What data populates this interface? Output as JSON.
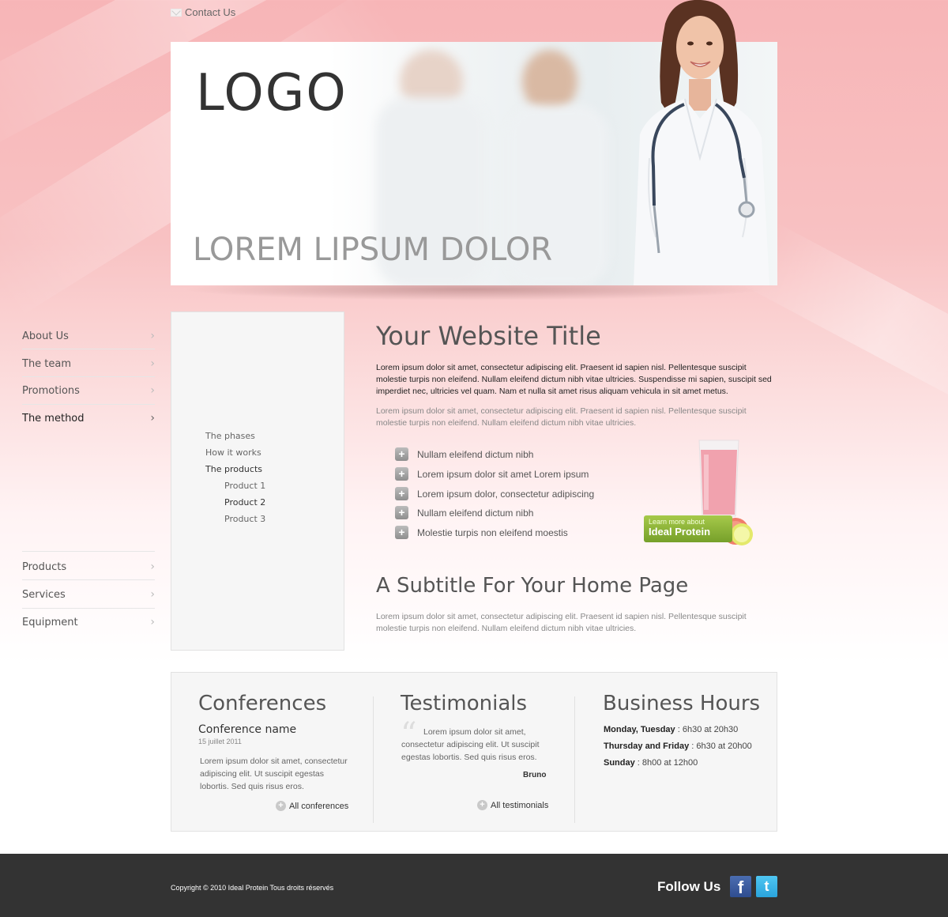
{
  "header": {
    "contact_label": "Contact Us"
  },
  "hero": {
    "logo_text": "LOGO",
    "tagline": "LOREM LIPSUM DOLOR"
  },
  "sidebar": {
    "items": [
      {
        "label": "About Us"
      },
      {
        "label": "The team"
      },
      {
        "label": "Promotions"
      },
      {
        "label": "The method"
      },
      {
        "label": "Products"
      },
      {
        "label": "Services"
      },
      {
        "label": "Equipment"
      }
    ],
    "sub_items": [
      {
        "label": "The phases"
      },
      {
        "label": "How it works"
      },
      {
        "label": "The products"
      }
    ],
    "sub_sub_items": [
      {
        "label": "Product 1"
      },
      {
        "label": "Product 2"
      },
      {
        "label": "Product 3"
      }
    ]
  },
  "main": {
    "title": "Your Website Title",
    "intro": "Lorem ipsum dolor sit amet, consectetur adipiscing elit. Praesent id sapien nisl. Pellentesque suscipit molestie turpis non eleifend. Nullam eleifend dictum nibh vitae ultricies. Suspendisse mi sapien, suscipit sed imperdiet nec, ultricies vel quam. Nam et nulla sit amet risus aliquam vehicula in sit amet metus.",
    "secondary": "Lorem ipsum dolor sit amet, consectetur adipiscing elit. Praesent id sapien nisl. Pellentesque suscipit molestie turpis non eleifend. Nullam eleifend dictum nibh vitae ultricies.",
    "bullets": [
      "Nullam eleifend dictum nibh",
      "Lorem ipsum dolor sit amet Lorem ipsum",
      "Lorem ipsum dolor, consectetur adipiscing",
      "Nullam eleifend dictum nibh",
      "Molestie turpis non eleifend moestis"
    ],
    "promo": {
      "line1": "Learn more about",
      "line2": "Ideal Protein"
    },
    "subtitle": "A Subtitle For Your Home Page",
    "subtitle_text": "Lorem ipsum dolor sit amet, consectetur adipiscing elit. Praesent id sapien nisl. Pellentesque suscipit molestie turpis non eleifend. Nullam eleifend dictum nibh vitae ultricies."
  },
  "conferences": {
    "title": "Conferences",
    "name": "Conference name",
    "date": "15 juillet 2011",
    "text": "Lorem ipsum dolor sit amet, consectetur adipiscing elit. Ut suscipit egestas lobortis. Sed quis risus eros.",
    "link": "All conferences"
  },
  "testimonials": {
    "title": "Testimonials",
    "text": "Lorem ipsum dolor sit amet, consectetur adipiscing elit. Ut suscipit egestas lobortis. Sed quis risus eros.",
    "author": "Bruno",
    "link": "All testimonials"
  },
  "hours": {
    "title": "Business Hours",
    "rows": [
      {
        "day": "Monday, Tuesday",
        "time": " : 6h30 at 20h30"
      },
      {
        "day": "Thursday and Friday",
        "time": " : 6h30 at 20h00"
      },
      {
        "day": "Sunday",
        "time": " : 8h00 at 12h00"
      }
    ]
  },
  "footer": {
    "copyright": "Copyright © 2010 Ideal Protein Tous droits réservés",
    "follow_label": "Follow Us",
    "facebook_glyph": "f",
    "twitter_glyph": "t"
  },
  "colors": {
    "background_pink": "#f7b5b7",
    "footer": "#333333",
    "promo_green": "#8ab43a",
    "facebook": "#3b5998",
    "twitter": "#33b5e5"
  }
}
